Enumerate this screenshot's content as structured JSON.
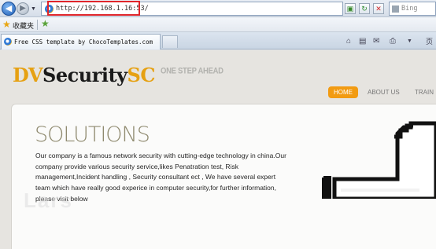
{
  "browser": {
    "address_prefix": "http://",
    "address_host": "192.168.1.16",
    "address_port": ":53/",
    "search_placeholder": "Bing",
    "favorites_label": "收藏夹",
    "tab_title": "Free CSS template by ChocoTemplates.com",
    "cmd_page_label": "页",
    "highlight_color": "#e0262b"
  },
  "site": {
    "logo_dv": "DV",
    "logo_security": "Security",
    "logo_sc": "SC",
    "tagline": "ONE STEP AHEAD",
    "nav": [
      "HOME",
      "ABOUT US",
      "TRAIN"
    ],
    "solutions_title": "SOLUTIONS",
    "solutions_text": "Our company is a famous network security with cutting-edge technology in china.Our company provide various security service,likes Penatration test, Risk management,Incident handling , Security consultant ect , We have several expert team which have really good experice in computer security,for further information, please visit below",
    "watermark": "Lars",
    "accent_color": "#e6a113",
    "nav_active_color": "#f29b12"
  }
}
